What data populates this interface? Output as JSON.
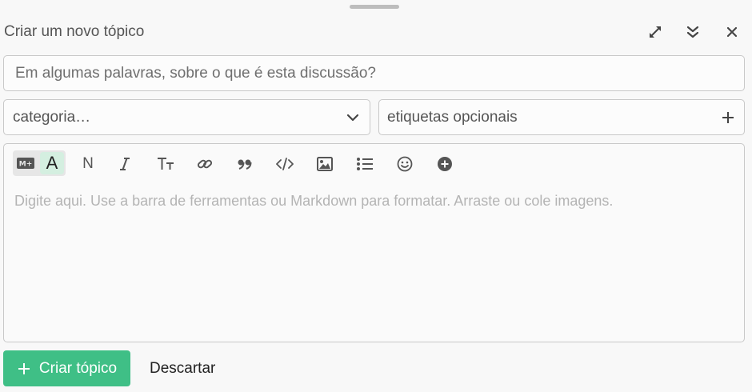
{
  "composer": {
    "title": "Criar um novo tópico",
    "header_icons": [
      "expand-fullscreen-icon",
      "collapse-icon",
      "close-icon"
    ],
    "topic_title": {
      "placeholder": "Em algumas palavras, sobre o que é esta discussão?",
      "value": ""
    },
    "category": {
      "selected": "categoria…"
    },
    "tags": {
      "placeholder": "etiquetas opcionais"
    },
    "toolbar": {
      "mode_markdown_icon": "M+",
      "mode_rich_label": "A",
      "icons": [
        "text-style-icon",
        "italic-icon",
        "heading-icon",
        "link-icon",
        "blockquote-icon",
        "code-icon",
        "image-upload-icon",
        "bulleted-list-icon",
        "emoji-icon",
        "more-options-icon"
      ],
      "text_style_glyph": "N"
    },
    "editor": {
      "placeholder": "Digite aqui. Use a barra de ferramentas ou Markdown para formatar. Arraste ou cole imagens.",
      "value": ""
    },
    "actions": {
      "create_label": "Criar tópico",
      "discard_label": "Descartar"
    },
    "colors": {
      "primary": "#3fbf86",
      "rich_toggle_bg": "#d4efe0"
    }
  }
}
